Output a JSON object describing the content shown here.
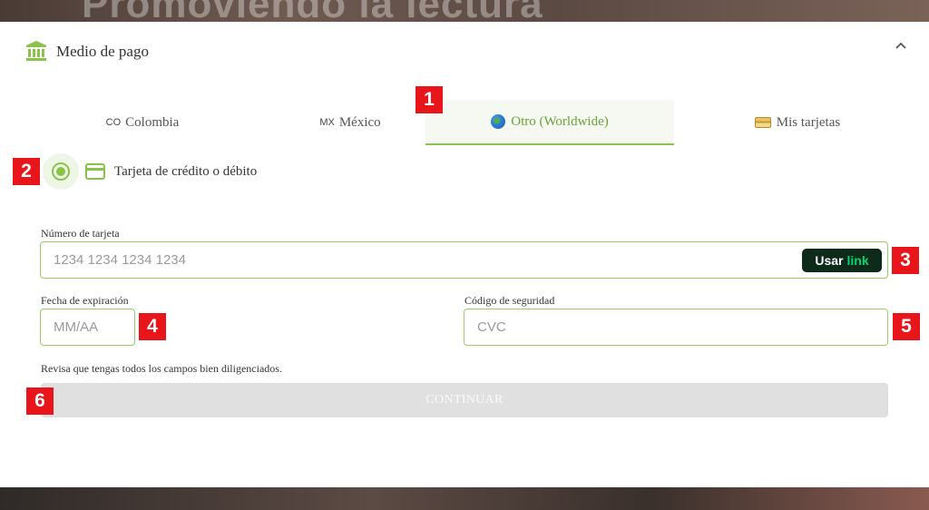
{
  "background_text": "Promoviendo la lectura",
  "header": {
    "title": "Medio de pago",
    "icon": "bank-icon",
    "collapse_icon": "chevron-up-icon"
  },
  "tabs": [
    {
      "code": "CO",
      "label": "Colombia",
      "active": false
    },
    {
      "code": "MX",
      "label": "México",
      "active": false
    },
    {
      "icon": "globe-icon",
      "label": "Otro (Worldwide)",
      "active": true
    },
    {
      "icon": "credit-card-icon",
      "label": "Mis tarjetas",
      "active": false
    }
  ],
  "payment_method": {
    "label": "Tarjeta de crédito o débito",
    "selected": true
  },
  "form": {
    "card_number": {
      "label": "Número de tarjeta",
      "placeholder": "1234 1234 1234 1234"
    },
    "link_button": {
      "prefix": "Usar",
      "brand": "link"
    },
    "expiry": {
      "label": "Fecha de expiración",
      "placeholder": "MM/AA"
    },
    "cvc": {
      "label": "Código de seguridad",
      "placeholder": "CVC"
    },
    "hint": "Revisa que tengas todos los campos bien diligenciados.",
    "continue_label": "CONTINUAR"
  },
  "markers": [
    "1",
    "2",
    "3",
    "4",
    "5",
    "6"
  ],
  "colors": {
    "accent": "#8bc34a",
    "marker": "#e8151b",
    "disabled_button": "#e0e0e0",
    "link_bg": "#0d2a1a",
    "link_green": "#00d66f"
  }
}
